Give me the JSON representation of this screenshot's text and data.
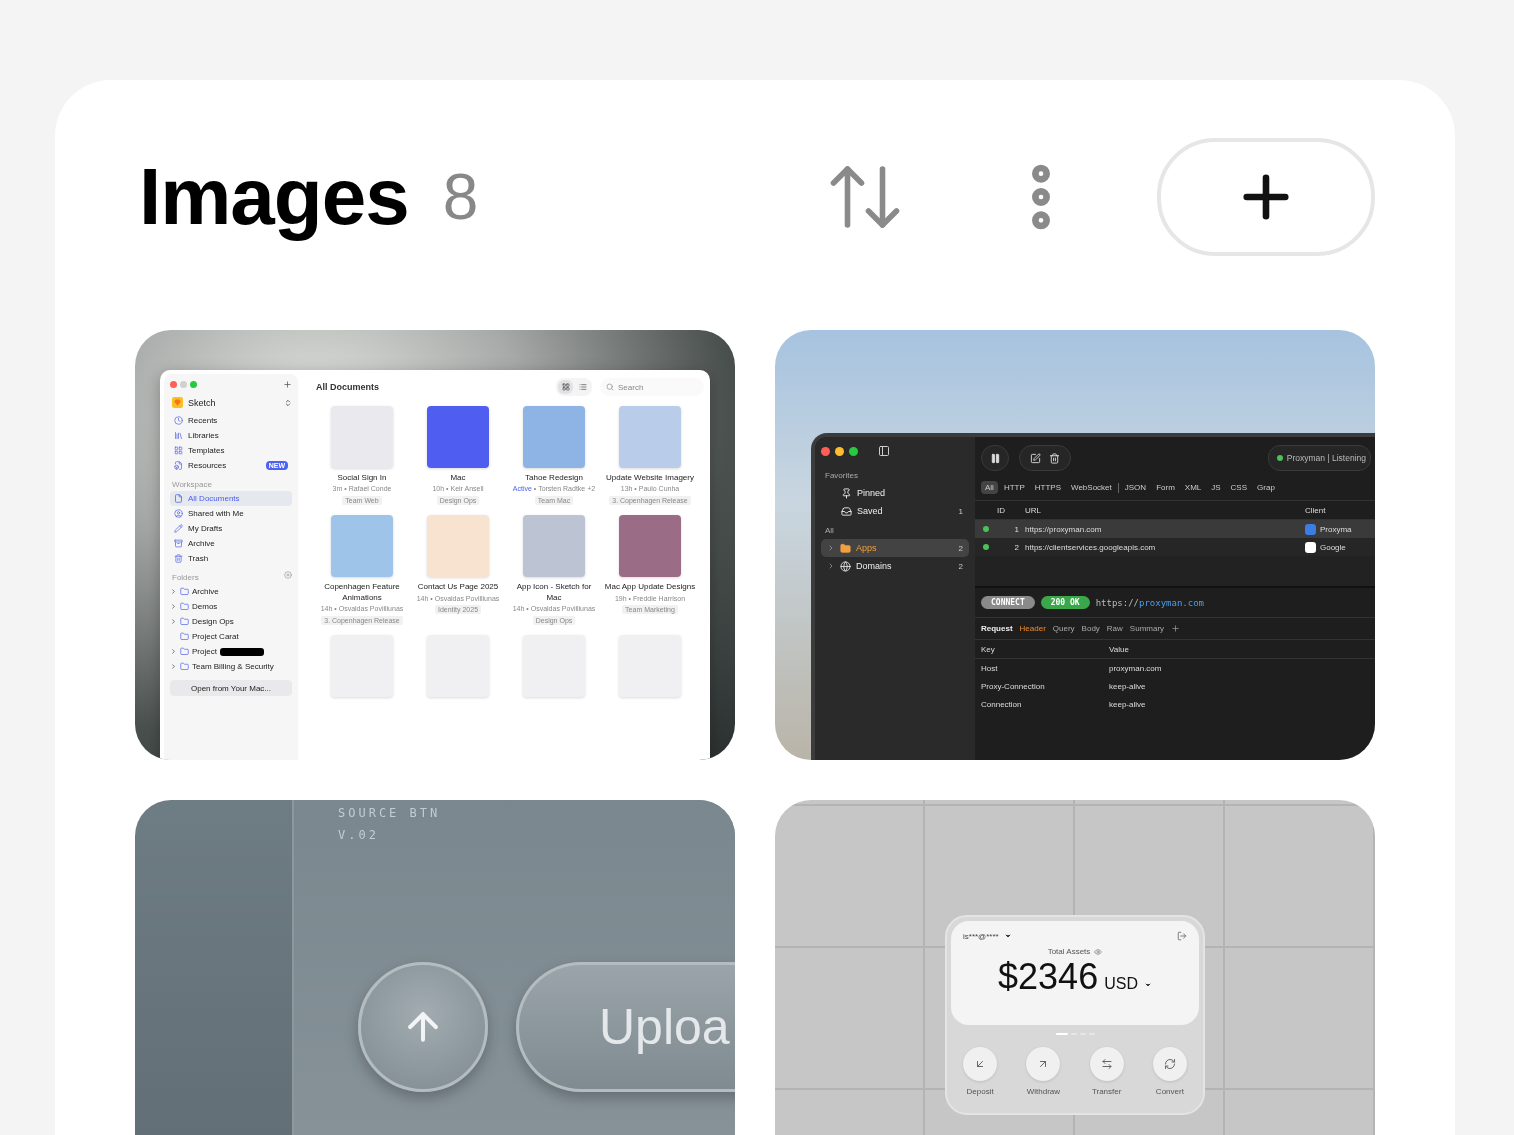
{
  "header": {
    "title": "Images",
    "count": "8"
  },
  "images": [
    {
      "kind": "sketch",
      "window": {
        "app_name": "Sketch",
        "section_title": "All Documents",
        "search_placeholder": "Search",
        "views": [
          {
            "selected": true
          },
          {
            "selected": false
          }
        ],
        "nav": [
          {
            "label": "Recents",
            "selected": false
          },
          {
            "label": "Libraries",
            "selected": false
          },
          {
            "label": "Templates",
            "selected": false
          },
          {
            "label": "Resources",
            "selected": false,
            "badge": "NEW"
          }
        ],
        "workspace_heading": "Workspace",
        "workspace": [
          {
            "label": "All Documents",
            "selected": true
          },
          {
            "label": "Shared with Me",
            "selected": false
          },
          {
            "label": "My Drafts",
            "selected": false
          },
          {
            "label": "Archive",
            "selected": false
          },
          {
            "label": "Trash",
            "selected": false
          }
        ],
        "folders_heading": "Folders",
        "folders": [
          {
            "label": "Archive",
            "expandable": true,
            "redacted": false
          },
          {
            "label": "Demos",
            "expandable": true,
            "redacted": false
          },
          {
            "label": "Design Ops",
            "expandable": true,
            "redacted": false
          },
          {
            "label": "Project Carat",
            "expandable": false,
            "redacted": false
          },
          {
            "label": "Project",
            "expandable": true,
            "redacted": true
          },
          {
            "label": "Team Billing & Security",
            "expandable": true,
            "redacted": false
          }
        ],
        "open_button": "Open from Your Mac...",
        "documents": [
          {
            "title": "Social Sign In",
            "meta": "3m • Rafael Conde",
            "tag": "Team Web",
            "color": "#e9e9ee"
          },
          {
            "title": "Mac",
            "meta": "10h • Keir Ansell",
            "tag": "Design Ops",
            "color": "#4f5df0"
          },
          {
            "title": "Tahoe Redesign",
            "status": "Active",
            "meta": " • Torsten Radtke +2",
            "tag": "Team Mac",
            "color": "#8db4e4"
          },
          {
            "title": "Update Website Imagery",
            "meta": "13h • Paulo Cunha",
            "tag": "3. Copenhagen Release",
            "color": "#b9cdea"
          },
          {
            "title": "Copenhagen Feature Animations",
            "meta": "14h • Osvaldas Povilliunas",
            "tag": "3. Copenhagen Release",
            "color": "#9fc4ea"
          },
          {
            "title": "Contact Us Page 2025",
            "meta": "14h • Osvaldas Povilliunas",
            "tag": "Identity 2025",
            "color": "#f7e3cf"
          },
          {
            "title": "App Icon - Sketch for Mac",
            "meta": "14h • Osvaldas Povilliunas",
            "tag": "Design Ops",
            "color": "#bcc3d3"
          },
          {
            "title": "Mac App Update Designs",
            "meta": "19h • Freddie Harrison",
            "tag": "Team Marketing",
            "color": "#9b6c86"
          }
        ]
      }
    },
    {
      "kind": "proxyman",
      "window": {
        "status": "Proxyman | Listening",
        "favorites_heading": "Favorites",
        "favorites": [
          {
            "label": "Pinned"
          },
          {
            "label": "Saved",
            "count": "1"
          }
        ],
        "all_heading": "All",
        "groups": [
          {
            "label": "Apps",
            "count": "2",
            "selected": true
          },
          {
            "label": "Domains",
            "count": "2",
            "selected": false
          }
        ],
        "filters": [
          {
            "label": "All",
            "selected": true
          },
          {
            "label": "HTTP",
            "selected": false
          },
          {
            "label": "HTTPS",
            "selected": false
          },
          {
            "label": "WebSocket",
            "selected": false
          },
          {
            "label": "JSON",
            "selected": false
          },
          {
            "label": "Form",
            "selected": false
          },
          {
            "label": "XML",
            "selected": false
          },
          {
            "label": "JS",
            "selected": false
          },
          {
            "label": "CSS",
            "selected": false
          },
          {
            "label": "Grap",
            "selected": false
          }
        ],
        "columns": [
          "ID",
          "URL",
          "Client"
        ],
        "rows": [
          {
            "id": "1",
            "url": "https://proxyman.com",
            "client": "Proxyma",
            "selected": true,
            "color": "#4cc15a"
          },
          {
            "id": "2",
            "url": "https://clientservices.googleapis.com",
            "client": "Google",
            "selected": false,
            "color": "#4cc15a"
          }
        ],
        "method": "CONNECT",
        "code": "200 OK",
        "url_scheme": "https://",
        "url_host": "proxyman.com",
        "detail_title": "Request",
        "detail_tabs": [
          {
            "label": "Header",
            "selected": true
          },
          {
            "label": "Query",
            "selected": false
          },
          {
            "label": "Body",
            "selected": false
          },
          {
            "label": "Raw",
            "selected": false
          },
          {
            "label": "Summary",
            "selected": false
          }
        ],
        "header_columns": [
          "Key",
          "Value"
        ],
        "headers": [
          {
            "key": "Host",
            "value": "proxyman.com"
          },
          {
            "key": "Proxy-Connection",
            "value": "keep-alive"
          },
          {
            "key": "Connection",
            "value": "keep-alive"
          }
        ]
      }
    },
    {
      "kind": "upload",
      "label": "SOURCE BTN",
      "version": "V.02",
      "button_text": "Uploa"
    },
    {
      "kind": "wallet",
      "account": "is***@****",
      "total_label": "Total Assets",
      "amount": "$2346",
      "currency": "USD",
      "pages": [
        {
          "selected": true
        },
        {
          "selected": false
        },
        {
          "selected": false
        },
        {
          "selected": false
        }
      ],
      "actions": [
        {
          "label": "Deposit",
          "kind": "deposit"
        },
        {
          "label": "Withdraw",
          "kind": "withdraw"
        },
        {
          "label": "Transfer",
          "kind": "transfer"
        },
        {
          "label": "Convert",
          "kind": "convert"
        }
      ]
    }
  ]
}
